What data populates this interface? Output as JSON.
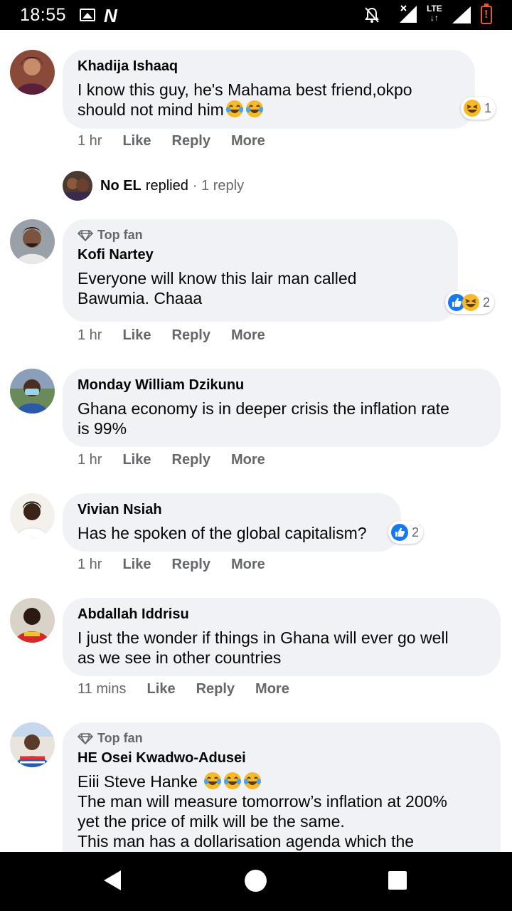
{
  "status_bar": {
    "time": "18:55",
    "network": "LTE",
    "icons": [
      "image-icon",
      "n-icon",
      "mute-icon",
      "signal-x-icon",
      "lte-icon",
      "signal-icon",
      "battery-low-icon"
    ]
  },
  "comments": [
    {
      "author": "Khadija Ishaaq",
      "text": "I know this guy, he's Mahama best friend,okpo\nshould not mind him",
      "time": "1 hr",
      "reaction_count": "1",
      "avatar_color": "#7a3b2e"
    },
    {
      "badge": "Top fan",
      "author": "Kofi Nartey",
      "text": "Everyone will know this lair man called\nBawumia. Chaaa",
      "time": "1 hr",
      "reaction_count": "2",
      "avatar_color": "#6b5a4e"
    },
    {
      "author": "Monday William Dzikunu",
      "text": "Ghana economy is in deeper crisis the inflation rate\nis 99%",
      "time": "1 hr",
      "avatar_color": "#4a6a8a"
    },
    {
      "author": "Vivian Nsiah",
      "text": "Has he spoken of the global capitalism?",
      "time": "1 hr",
      "reaction_count": "2",
      "avatar_color": "#f1e6dc"
    },
    {
      "author": "Abdallah Iddrisu",
      "text": "I just the wonder if things in Ghana will ever go well\nas we see in other countries",
      "time": "11 mins",
      "avatar_color": "#c93b2f"
    },
    {
      "badge": "Top fan",
      "author": "HE Osei Kwadwo-Adusei",
      "text_line1": "Eiii Steve Hanke ",
      "text": "The man will measure tomorrow’s inflation at 200%\nyet the price of milk will be the same.\nThis man has a dollarisation agenda which the",
      "avatar_color": "#3d6bb3"
    }
  ],
  "reply_summary": {
    "name": "No EL",
    "action": "replied",
    "count": "· 1 reply"
  },
  "actions": {
    "like": "Like",
    "reply": "Reply",
    "more": "More"
  },
  "colors": {
    "bubble": "#f0f2f5",
    "secondary_text": "#65676b",
    "like_blue": "#1877f2",
    "haha_yellow": "#f7b928"
  }
}
